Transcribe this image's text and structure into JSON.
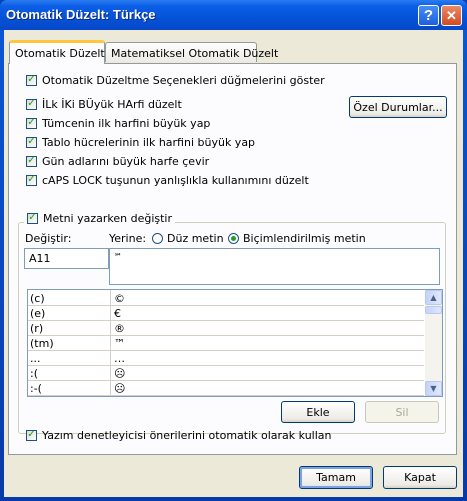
{
  "window": {
    "title": "Otomatik Düzelt: Türkçe",
    "help_glyph": "?",
    "close_glyph": "✕"
  },
  "tabs": [
    {
      "label": "Otomatik Düzelt",
      "active": true
    },
    {
      "label": "Matematiksel Otomatik Düzelt",
      "active": false
    }
  ],
  "options": {
    "show_buttons": {
      "label": "Otomatik Düzeltme Seçenekleri düğmelerini göster",
      "checked": true
    },
    "two_initial_caps": {
      "label": "İLk İKi BÜyük HArfi düzelt",
      "checked": true
    },
    "capitalize_sentence": {
      "label": "Tümcenin ilk harfini büyük yap",
      "checked": true
    },
    "capitalize_table_cells": {
      "label": "Tablo hücrelerinin ilk harfini büyük yap",
      "checked": true
    },
    "capitalize_days": {
      "label": "Gün adlarını büyük harfe çevir",
      "checked": true
    },
    "caps_lock": {
      "label": "cAPS LOCK tuşunun yanlışlıkla kullanımını düzelt",
      "checked": true
    }
  },
  "exceptions_button": "Özel Durumlar...",
  "replace_group": {
    "label": "Metni yazarken değiştir",
    "checked": true,
    "replace_label": "Değiştir:",
    "with_label": "Yerine:",
    "radio_plain": "Düz metin",
    "radio_formatted": "Biçimlendirilmiş metin",
    "replace_value": "A11",
    "with_value": "℠"
  },
  "entries": [
    {
      "from": "(c)",
      "to": "©"
    },
    {
      "from": "(e)",
      "to": "€"
    },
    {
      "from": "(r)",
      "to": "®"
    },
    {
      "from": "(tm)",
      "to": "™"
    },
    {
      "from": "...",
      "to": "…"
    },
    {
      "from": ":(",
      "to": "☹"
    },
    {
      "from": ":-(",
      "to": "☹"
    }
  ],
  "add_button": "Ekle",
  "delete_button": "Sil",
  "spellcheck": {
    "label": "Yazım denetleyicisi önerilerini otomatik olarak kullan",
    "checked": true
  },
  "ok_button": "Tamam",
  "cancel_button": "Kapat",
  "colors": {
    "titlebar": "#0552d8",
    "dialog": "#ece9d8",
    "check": "#21a121"
  }
}
